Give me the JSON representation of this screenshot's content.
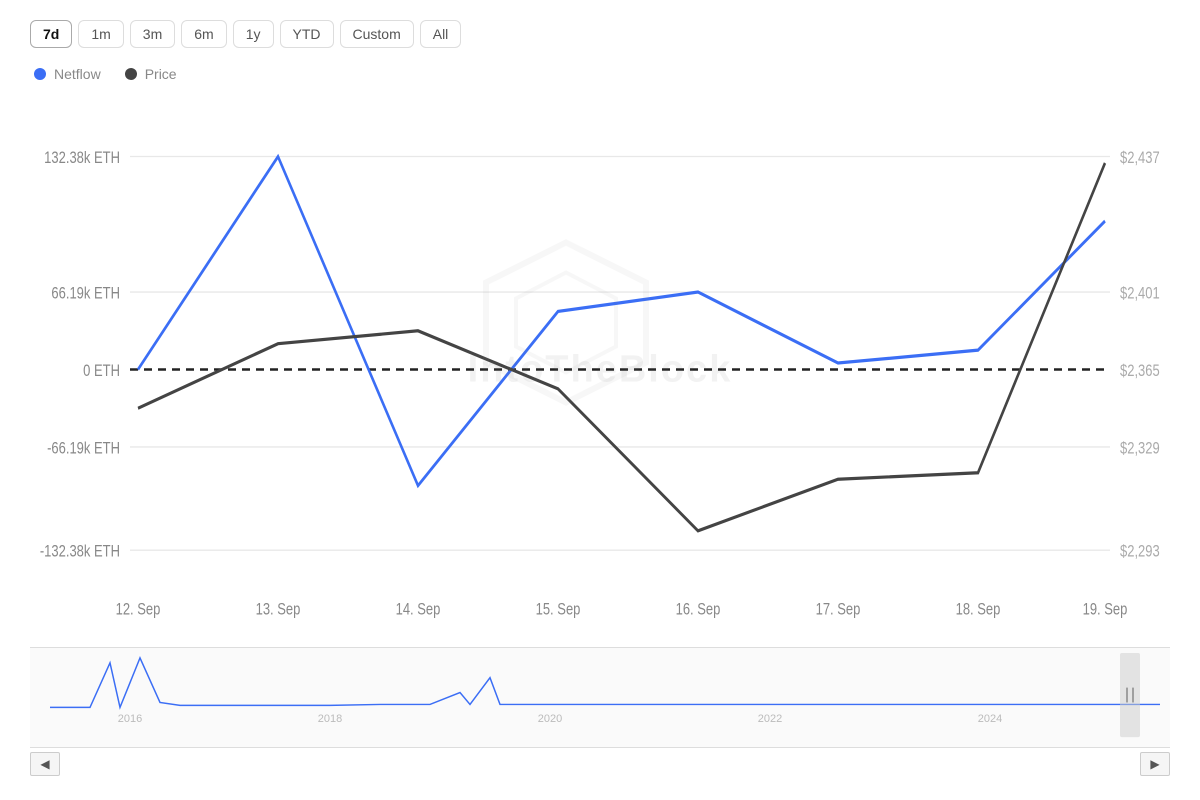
{
  "timeRange": {
    "buttons": [
      {
        "label": "7d",
        "active": true
      },
      {
        "label": "1m",
        "active": false
      },
      {
        "label": "3m",
        "active": false
      },
      {
        "label": "6m",
        "active": false
      },
      {
        "label": "1y",
        "active": false
      },
      {
        "label": "YTD",
        "active": false
      },
      {
        "label": "Custom",
        "active": false
      },
      {
        "label": "All",
        "active": false
      }
    ]
  },
  "legend": {
    "netflow_label": "Netflow",
    "price_label": "Price"
  },
  "yAxis": {
    "left": [
      "132.38k ETH",
      "66.19k ETH",
      "0 ETH",
      "-66.19k ETH",
      "-132.38k ETH"
    ],
    "right": [
      "$2,437",
      "$2,401",
      "$2,365",
      "$2,329",
      "$2,293"
    ]
  },
  "xAxis": {
    "labels": [
      "12. Sep",
      "13. Sep",
      "14. Sep",
      "15. Sep",
      "16. Sep",
      "17. Sep",
      "18. Sep",
      "19. Sep"
    ]
  },
  "miniChart": {
    "yearLabels": [
      "2016",
      "2018",
      "2020",
      "2022",
      "2024"
    ]
  },
  "watermark": "IntoTheBlock"
}
